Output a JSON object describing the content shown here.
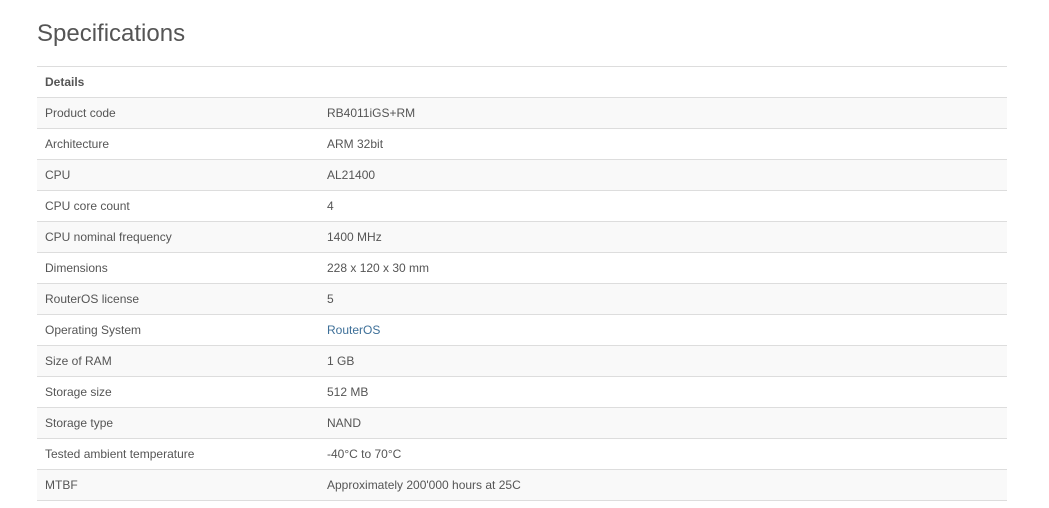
{
  "page": {
    "title": "Specifications"
  },
  "table": {
    "header": "Details",
    "rows": [
      {
        "label": "Product code",
        "value": "RB4011iGS+RM"
      },
      {
        "label": "Architecture",
        "value": "ARM 32bit"
      },
      {
        "label": "CPU",
        "value": "AL21400"
      },
      {
        "label": "CPU core count",
        "value": "4"
      },
      {
        "label": "CPU nominal frequency",
        "value": "1400 MHz"
      },
      {
        "label": "Dimensions",
        "value": "228 x 120 x 30 mm"
      },
      {
        "label": "RouterOS license",
        "value": "5"
      },
      {
        "label": "Operating System",
        "value": "RouterOS"
      },
      {
        "label": "Size of RAM",
        "value": "1 GB"
      },
      {
        "label": "Storage size",
        "value": "512 MB"
      },
      {
        "label": "Storage type",
        "value": "NAND"
      },
      {
        "label": "Tested ambient temperature",
        "value": "-40°C to 70°C"
      },
      {
        "label": "MTBF",
        "value": "Approximately 200'000 hours at 25C"
      }
    ]
  },
  "colors": {
    "text": "#555555",
    "link": "#3d6f98",
    "row_stripe": "#f9f9f9",
    "border": "#dddddd"
  }
}
